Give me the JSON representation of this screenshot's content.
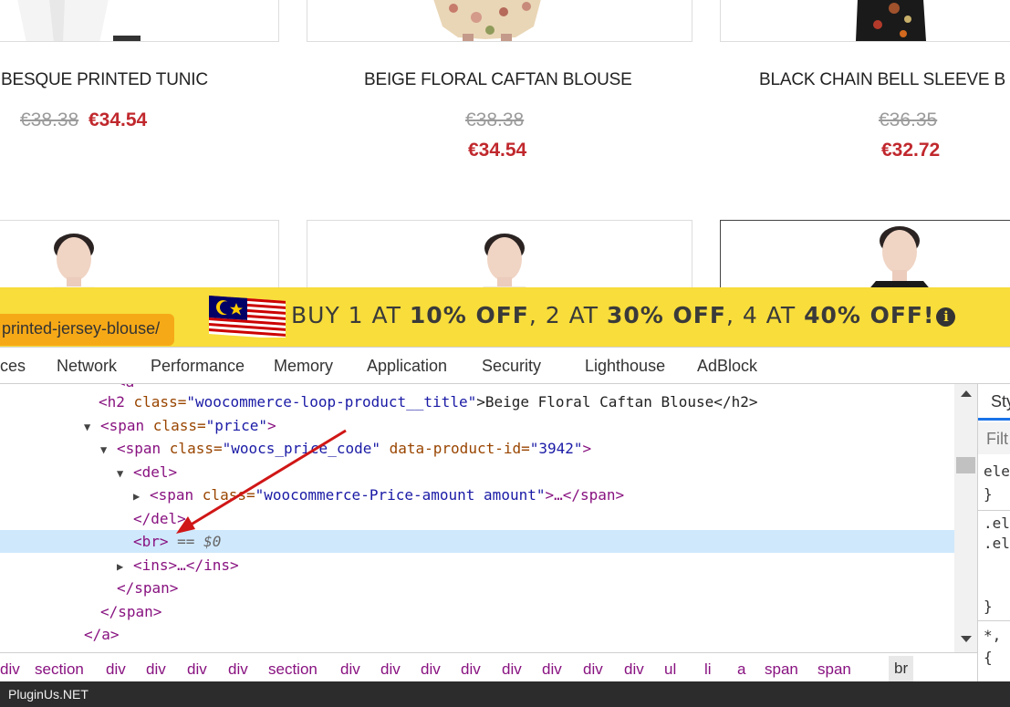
{
  "products": [
    {
      "title": "BESQUE PRINTED TUNIC",
      "price_old": "€38.38",
      "price_new": "€34.54"
    },
    {
      "title": "BEIGE FLORAL CAFTAN BLOUSE",
      "price_old": "€38.38",
      "price_new": "€34.54"
    },
    {
      "title": "BLACK CHAIN BELL SLEEVE B",
      "price_old": "€36.35",
      "price_new": "€32.72"
    }
  ],
  "banner": {
    "parts": [
      "BUY 1 AT ",
      "10% OFF",
      ", 2 AT ",
      "30% OFF",
      ", 4 AT ",
      "40% OFF!"
    ],
    "info_glyph": "i",
    "flag": "malaysia-flag-icon",
    "colors": {
      "background": "#f8dd3b",
      "url_tooltip": "#f6a917"
    }
  },
  "url_tooltip": "printed-jersey-blouse/",
  "devtools": {
    "tabs": [
      "ces",
      "Network",
      "Performance",
      "Memory",
      "Application",
      "Security",
      "Lighthouse",
      "AdBlock"
    ],
    "elements": {
      "lines": [
        {
          "tag_open": "<h2 ",
          "attr": "class=",
          "val": "\"woocommerce-loop-product__title\"",
          "text": ">Beige Floral Caftan Blouse</h2>"
        },
        {
          "tri": "▼",
          "tag_open": "<span ",
          "attr": "class=",
          "val": "\"price\"",
          "text": ">"
        },
        {
          "tri": "▼",
          "tag_open": "<span ",
          "attr": "class=",
          "val": "\"woocs_price_code\"",
          "attr2": " data-product-id=",
          "val2": "\"3942\"",
          "text": ">"
        },
        {
          "tri": "▼",
          "tag_open": "<del>"
        },
        {
          "tri": "▶",
          "tag_open": "<span ",
          "attr": "class=",
          "val": "\"woocommerce-Price-amount amount\"",
          "text": ">…</span>"
        },
        {
          "tag_open": "</del>"
        },
        {
          "tag_open": "<br>",
          "suffix": " == $0"
        },
        {
          "tri": "▶",
          "tag_open": "<ins>",
          "text": "…</ins>"
        },
        {
          "tag_open": "</span>"
        },
        {
          "tag_open": "</span>"
        },
        {
          "tag_open": "</a>"
        }
      ]
    },
    "styles": {
      "tab": "Sty",
      "filter_placeholder": "Filt",
      "lines": [
        "ele",
        "}",
        ".el",
        ".el",
        "}",
        "*,",
        "{"
      ]
    },
    "breadcrumbs": [
      "div",
      "section",
      "div",
      "div",
      "div",
      "div",
      "section",
      "div",
      "div",
      "div",
      "div",
      "div",
      "div",
      "div",
      "div",
      "ul",
      "li",
      "a",
      "span",
      "span",
      "br"
    ]
  },
  "footer": "PluginUs.NET"
}
